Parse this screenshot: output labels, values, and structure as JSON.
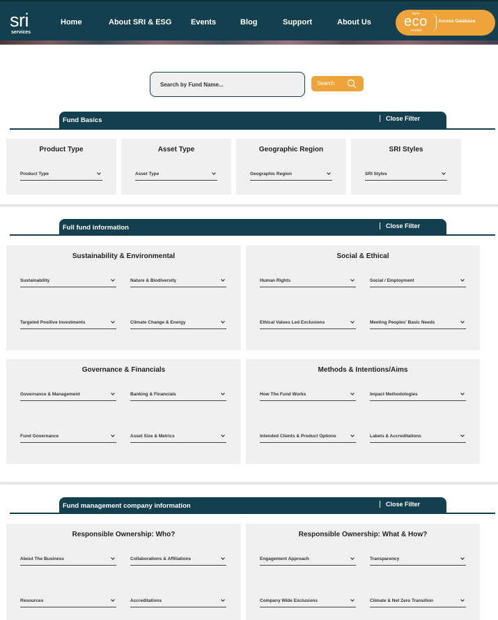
{
  "logo": {
    "main": "sri",
    "sub": "services"
  },
  "nav": [
    "Home",
    "About SRI & ESG",
    "Events",
    "Blog",
    "Support",
    "About Us"
  ],
  "eco": {
    "top": "fund",
    "word": "eco",
    "bottom": "market",
    "label": "Access Database"
  },
  "search": {
    "placeholder": "Search by Fund Name...",
    "button": "Search"
  },
  "close_label": "Close Filter",
  "sections": {
    "basics": {
      "title": "Fund Basics",
      "panels": [
        {
          "title": "Product Type",
          "dropdown": "Product Type"
        },
        {
          "title": "Asset Type",
          "dropdown": "Asset Type"
        },
        {
          "title": "Geographic Region",
          "dropdown": "Geographic Region"
        },
        {
          "title": "SRI Styles",
          "dropdown": "SRI Styles"
        }
      ]
    },
    "full": {
      "title": "Full fund information",
      "panels": [
        {
          "title": "Sustainability & Environmental",
          "dropdowns": [
            "Sustainability",
            "Nature & Biodiversity",
            "Targeted Positive Investments",
            "Climate Change & Energy"
          ]
        },
        {
          "title": "Social & Ethical",
          "dropdowns": [
            "Human Rights",
            "Social / Employment",
            "Ethical Values Led Exclusions",
            "Meeting Peoples' Basic Needs"
          ]
        },
        {
          "title": "Governance & Financials",
          "dropdowns": [
            "Governance & Management",
            "Banking & Financials",
            "Fund Governance",
            "Asset Size & Metrics"
          ]
        },
        {
          "title": "Methods & Intentions/Aims",
          "dropdowns": [
            "How The Fund Works",
            "Impact Methodologies",
            "Intended Clients & Product Options",
            "Labels & Accreditations"
          ]
        }
      ]
    },
    "company": {
      "title": "Fund management company information",
      "panels": [
        {
          "title": "Responsible Ownership: Who?",
          "dropdowns": [
            "About The Business",
            "Collaborations & Affiliations",
            "Resources",
            "Accreditations"
          ]
        },
        {
          "title": "Responsible Ownership: What & How?",
          "dropdowns": [
            "Engagement Approach",
            "Transparency",
            "Company Wide Exclusions",
            "Climate & Net Zero Transition"
          ]
        }
      ]
    }
  }
}
